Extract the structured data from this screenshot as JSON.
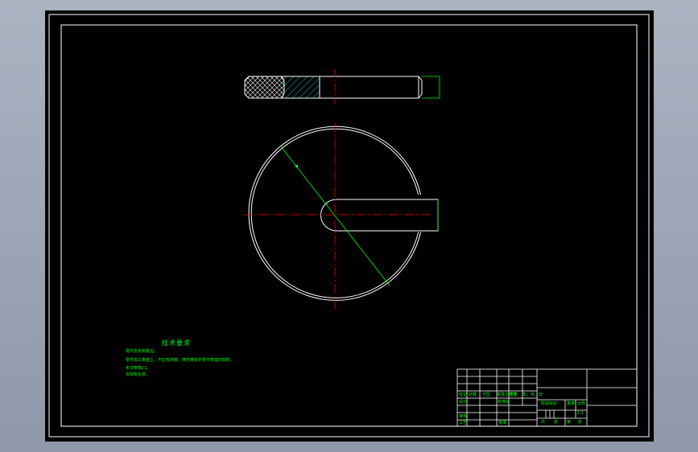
{
  "technical_requirements": {
    "title": "技术要求",
    "notes": [
      "零件去毛刺锐边。",
      "零件加工表面上，不应有划痕、擦伤等损伤零件表面的缺陷。",
      "未注倒角C1。",
      "去除氧化皮。"
    ]
  },
  "title_block": {
    "mark": "标记",
    "count": "处数",
    "zone": "分区",
    "change_doc": "更改文件号",
    "signature": "签名",
    "date": "年、月、日",
    "designer": "设计",
    "standardization": "标准化",
    "checker": "审核",
    "craft": "工艺",
    "approve": "批准",
    "stage_mark": "阶段标记",
    "weight": "重量",
    "scale": "比例",
    "scale_value": "1:1",
    "sheet_total": "共",
    "sheet_num": "张",
    "sheet_of": "第",
    "sheet_page": "张"
  }
}
